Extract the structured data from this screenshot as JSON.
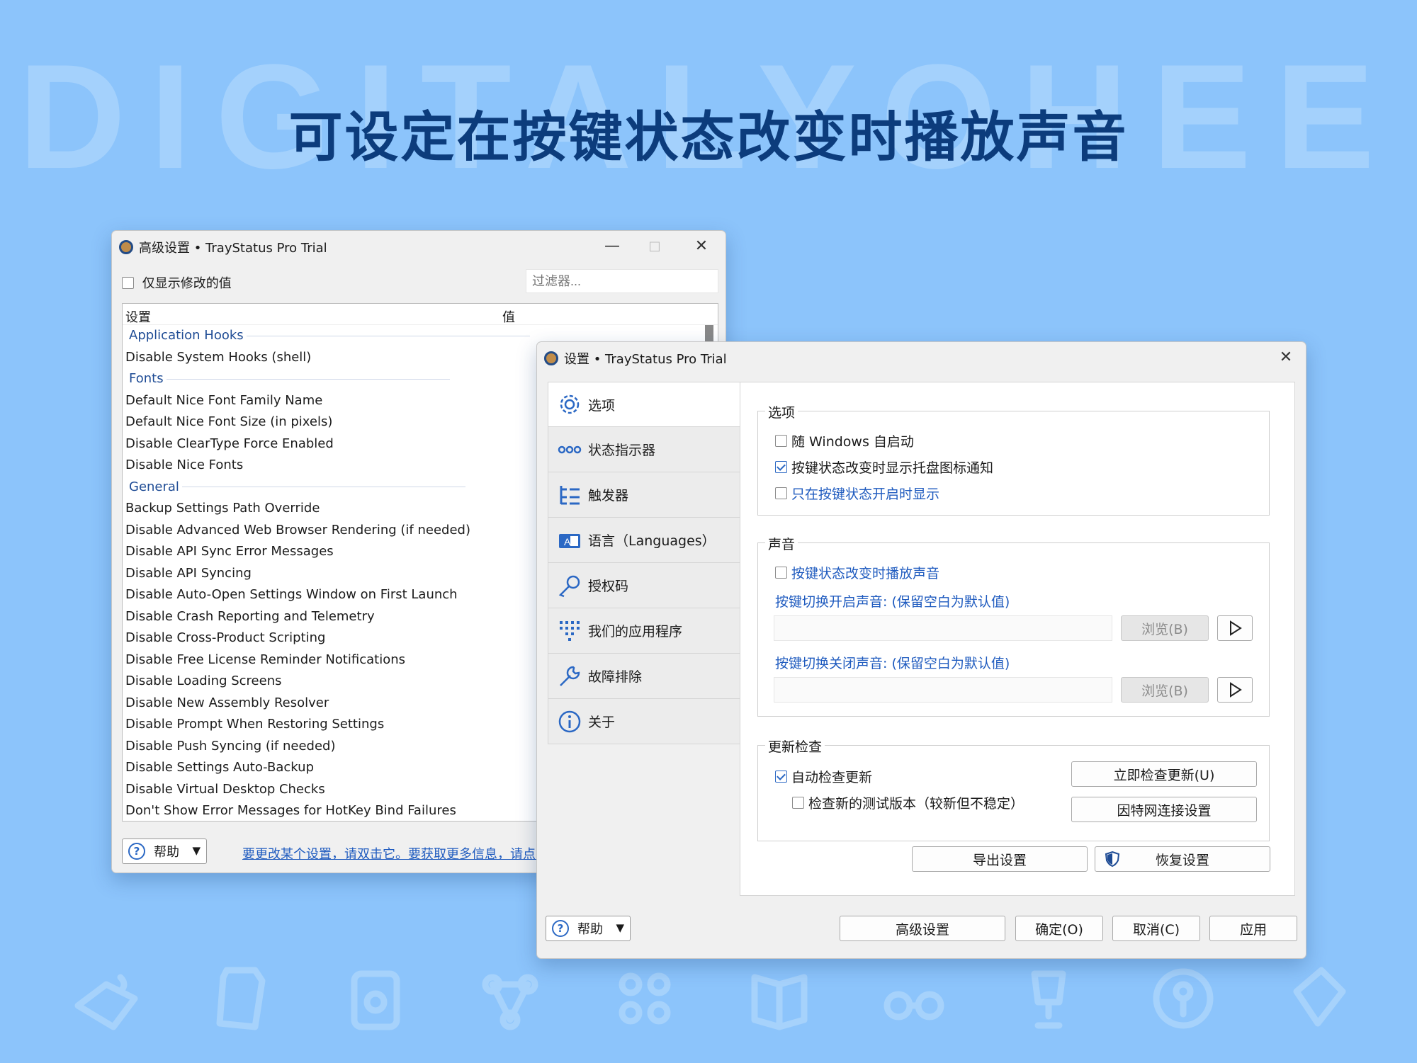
{
  "banner": {
    "watermark": "DIGITALYOHEE",
    "headline": "可设定在按键状态改变时播放声音"
  },
  "adv": {
    "title": "高级设置 • TrayStatus Pro Trial",
    "only_modified": "仅显示修改的值",
    "filter_placeholder": "过滤器...",
    "col_setting": "设置",
    "col_value": "值",
    "rows": [
      {
        "type": "group",
        "text": "Application Hooks"
      },
      {
        "type": "item",
        "text": "Disable System Hooks (shell)"
      },
      {
        "type": "group",
        "text": "Fonts"
      },
      {
        "type": "item",
        "text": "Default Nice Font Family Name"
      },
      {
        "type": "item",
        "text": "Default Nice Font Size (in pixels)"
      },
      {
        "type": "item",
        "text": "Disable ClearType Force Enabled"
      },
      {
        "type": "item",
        "text": "Disable Nice Fonts"
      },
      {
        "type": "group",
        "text": "General"
      },
      {
        "type": "item",
        "text": "Backup Settings Path Override"
      },
      {
        "type": "item",
        "text": "Disable Advanced Web Browser Rendering (if needed)"
      },
      {
        "type": "item",
        "text": "Disable API Sync Error Messages"
      },
      {
        "type": "item",
        "text": "Disable API Syncing"
      },
      {
        "type": "item",
        "text": "Disable Auto-Open Settings Window on First Launch"
      },
      {
        "type": "item",
        "text": "Disable Crash Reporting and Telemetry"
      },
      {
        "type": "item",
        "text": "Disable Cross-Product Scripting"
      },
      {
        "type": "item",
        "text": "Disable Free License Reminder Notifications"
      },
      {
        "type": "item",
        "text": "Disable Loading Screens"
      },
      {
        "type": "item",
        "text": "Disable New Assembly Resolver"
      },
      {
        "type": "item",
        "text": "Disable Prompt When Restoring Settings"
      },
      {
        "type": "item",
        "text": "Disable Push Syncing (if needed)"
      },
      {
        "type": "item",
        "text": "Disable Settings Auto-Backup"
      },
      {
        "type": "item",
        "text": "Disable Virtual Desktop Checks"
      },
      {
        "type": "item",
        "text": "Don't Show Error Messages for HotKey Bind Failures"
      }
    ],
    "help_label": "帮助",
    "help_link": "要更改某个设置，请双击它。要获取更多信息，请点击"
  },
  "settings": {
    "title": "设置 • TrayStatus Pro Trial",
    "nav": [
      {
        "label": "选项",
        "icon": "gear-icon"
      },
      {
        "label": "状态指示器",
        "icon": "dots-icon"
      },
      {
        "label": "触发器",
        "icon": "tree-list-icon"
      },
      {
        "label": "语言（Languages）",
        "icon": "language-icon"
      },
      {
        "label": "授权码",
        "icon": "key-icon"
      },
      {
        "label": "我们的应用程序",
        "icon": "apps-grid-icon"
      },
      {
        "label": "故障排除",
        "icon": "wrench-icon"
      },
      {
        "label": "关于",
        "icon": "info-icon"
      }
    ],
    "options": {
      "legend": "选项",
      "autostart": "随 Windows 自启动",
      "tray_notify": "按键状态改变时显示托盘图标通知",
      "only_on": "只在按键状态开启时显示"
    },
    "sound": {
      "legend": "声音",
      "play_sound": "按键状态改变时播放声音",
      "on_label": "按键切换开启声音: (保留空白为默认值)",
      "off_label": "按键切换关闭声音: (保留空白为默认值)",
      "browse": "浏览(B)"
    },
    "update": {
      "legend": "更新检查",
      "auto": "自动检查更新",
      "beta": "检查新的测试版本（较新但不稳定）",
      "check_now": "立即检查更新(U)",
      "proxy": "因特网连接设置"
    },
    "export": "导出设置",
    "restore": "恢复设置",
    "help_label": "帮助",
    "footer": {
      "advanced": "高级设置",
      "ok": "确定(O)",
      "cancel": "取消(C)",
      "apply": "应用"
    }
  }
}
